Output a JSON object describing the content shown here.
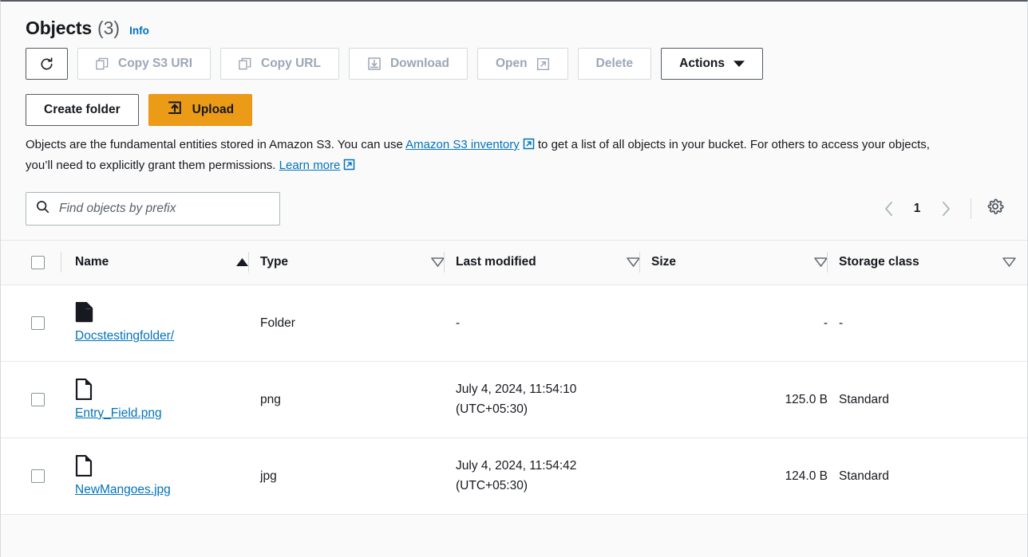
{
  "header": {
    "title": "Objects",
    "count": "(3)",
    "info_label": "Info"
  },
  "toolbar": {
    "refresh_label": "",
    "copy_s3_uri_label": "Copy S3 URI",
    "copy_url_label": "Copy URL",
    "download_label": "Download",
    "open_label": "Open",
    "delete_label": "Delete",
    "actions_label": "Actions",
    "create_folder_label": "Create folder",
    "upload_label": "Upload"
  },
  "description": {
    "part1": "Objects are the fundamental entities stored in Amazon S3. You can use ",
    "link1": "Amazon S3 inventory",
    "part2": " to get a list of all objects in your bucket. For others to access your objects, you’ll need to explicitly grant them permissions. ",
    "link2": "Learn more"
  },
  "search": {
    "placeholder": "Find objects by prefix",
    "value": ""
  },
  "pagination": {
    "prev_label": "",
    "page": "1",
    "next_label": ""
  },
  "table": {
    "columns": [
      {
        "label": "Name",
        "sort": "asc"
      },
      {
        "label": "Type",
        "sort": "none"
      },
      {
        "label": "Last modified",
        "sort": "none"
      },
      {
        "label": "Size",
        "sort": "none"
      },
      {
        "label": "Storage class",
        "sort": "none"
      }
    ],
    "rows": [
      {
        "name": "Docstestingfolder/",
        "icon": "folder-icon",
        "type": "Folder",
        "last_modified": "-",
        "size": "-",
        "storage_class": "-"
      },
      {
        "name": "Entry_Field.png",
        "icon": "file-icon",
        "type": "png",
        "last_modified": "July 4, 2024, 11:54:10 (UTC+05:30)",
        "size": "125.0 B",
        "storage_class": "Standard"
      },
      {
        "name": "NewMangoes.jpg",
        "icon": "file-icon",
        "type": "jpg",
        "last_modified": "July 4, 2024, 11:54:42 (UTC+05:30)",
        "size": "124.0 B",
        "storage_class": "Standard"
      }
    ]
  },
  "colors": {
    "accent_orange": "#ec9b17",
    "link_blue": "#0073bb",
    "text_dark": "#16191f",
    "disabled_gray": "#9ba7b6",
    "border_gray": "#d5dbdb"
  }
}
